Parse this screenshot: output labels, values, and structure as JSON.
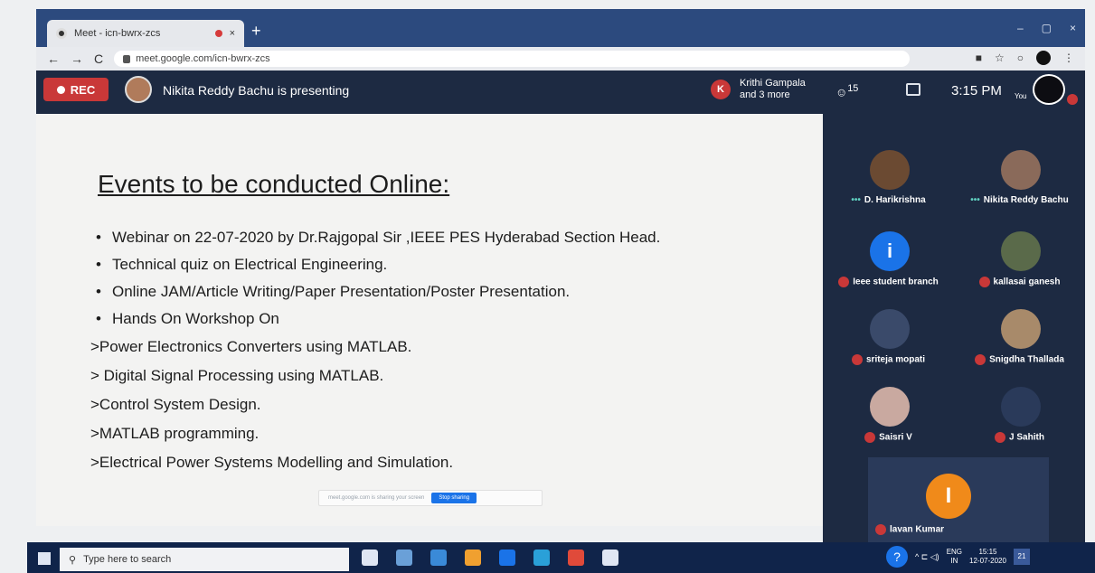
{
  "browser": {
    "tab_title": "Meet - icn-bwrx-zcs",
    "url": "meet.google.com/icn-bwrx-zcs",
    "new_tab_glyph": "+",
    "nav_back": "←",
    "nav_forward": "→",
    "nav_reload": "C",
    "tab_close": "×",
    "win_min": "–",
    "win_restore": "▢",
    "win_close": "×",
    "tb_icons": [
      "■",
      "☆",
      "○"
    ],
    "kebab": "⋮"
  },
  "meet": {
    "rec_label": "REC",
    "presenting_text": "Nikita Reddy Bachu is presenting",
    "k_badge": "K",
    "krithi_line1": "Krithi Gampala",
    "krithi_line2": "and 3 more",
    "people_count": "15",
    "time": "3:15 PM",
    "you_label": "You"
  },
  "slide": {
    "title": "Events to be conducted Online:",
    "bullets": [
      "Webinar on 22-07-2020 by Dr.Rajgopal Sir ,IEEE PES Hyderabad Section Head.",
      "Technical quiz on Electrical Engineering.",
      "Online JAM/Article Writing/Paper Presentation/Poster Presentation.",
      "Hands On Workshop On"
    ],
    "sub_items": [
      ">Power Electronics Converters using MATLAB.",
      "> Digital Signal Processing using MATLAB.",
      ">Control System Design.",
      ">MATLAB programming.",
      ">Electrical Power Systems Modelling and Simulation."
    ],
    "share_message": "meet.google.com is sharing your screen",
    "stop_sharing": "Stop sharing"
  },
  "participants": [
    {
      "name": "D. Harikrishna",
      "muted": false,
      "color": "#6b4a32"
    },
    {
      "name": "Nikita Reddy Bachu",
      "muted": false,
      "color": "#8a6a5a"
    },
    {
      "name": "Ieee student branch",
      "muted": true,
      "color": "#1a73e8",
      "initial": "i"
    },
    {
      "name": "kallasai ganesh",
      "muted": true,
      "color": "#5a6a4a"
    },
    {
      "name": "sriteja mopati",
      "muted": true,
      "color": "#3a4a6a"
    },
    {
      "name": "Snigdha Thallada",
      "muted": true,
      "color": "#a88a6a"
    },
    {
      "name": "Saisri V",
      "muted": true,
      "color": "#c9a9a0"
    },
    {
      "name": "J Sahith",
      "muted": true,
      "color": "#2a3a5a"
    }
  ],
  "spotlight": {
    "name": "lavan Kumar",
    "initial": "I"
  },
  "taskbar": {
    "search_placeholder": "Type here to search",
    "help_glyph": "?",
    "tray_icons": "^ ⊏ ◁)",
    "lang1": "ENG",
    "lang2": "IN",
    "time": "15:15",
    "date": "12-07-2020",
    "notif": "21",
    "icon_colors": [
      "#dfe6f3",
      "#6aa0d8",
      "#3a8ad8",
      "#f0a030",
      "#1a73e8",
      "#2aa0d8",
      "#e04a3a",
      "#dfe6f3"
    ]
  }
}
